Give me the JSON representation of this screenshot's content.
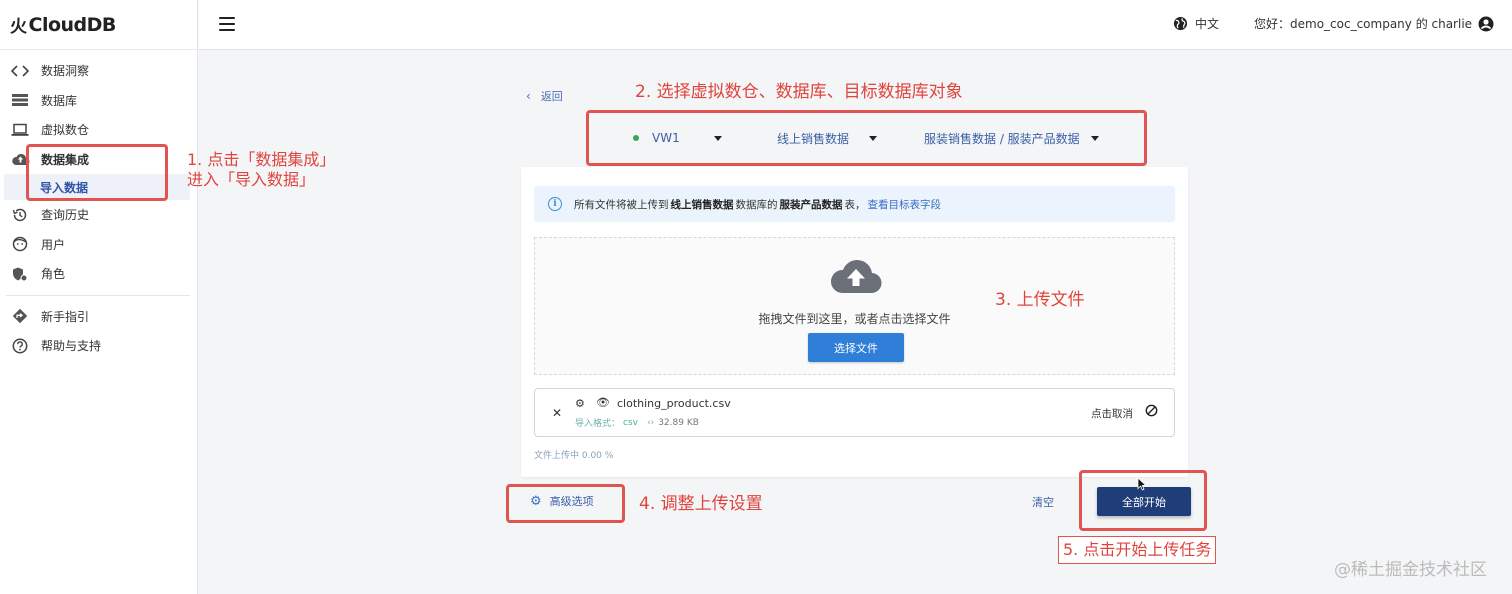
{
  "app": {
    "logo_text": "CloudDB",
    "logo_symbol": "⽕"
  },
  "sidebar": {
    "items": [
      {
        "label": "数据洞察",
        "icon": "code-icon"
      },
      {
        "label": "数据库",
        "icon": "database-icon"
      },
      {
        "label": "虚拟数仓",
        "icon": "laptop-icon"
      },
      {
        "label": "数据集成",
        "icon": "cloud-upload-icon"
      },
      {
        "label": "导入数据",
        "icon": ""
      },
      {
        "label": "查询历史",
        "icon": "history-icon"
      },
      {
        "label": "用户",
        "icon": "user-face-icon"
      },
      {
        "label": "角色",
        "icon": "role-shield-icon"
      }
    ],
    "bottom_items": [
      {
        "label": "新手指引",
        "icon": "guide-diamond-icon"
      },
      {
        "label": "帮助与支持",
        "icon": "help-icon"
      }
    ]
  },
  "header": {
    "language": "中文",
    "greeting": "您好：demo_coc_company 的 charlie"
  },
  "main": {
    "back_label": "返回",
    "selectors": {
      "warehouse": "VW1",
      "database": "线上销售数据",
      "table": "服装销售数据 / 服装产品数据"
    },
    "info": {
      "prefix": "所有文件将被上传到",
      "database": "线上销售数据",
      "middle": "数据库的",
      "table": "服装产品数据",
      "suffix": "表，",
      "link": "查看目标表字段"
    },
    "dropzone": {
      "text": "拖拽文件到这里，或者点击选择文件",
      "button": "选择文件"
    },
    "file": {
      "name": "clothing_product.csv",
      "format_label": "导入格式：",
      "format_value": "csv",
      "size": "32.89 KB",
      "cancel": "点击取消"
    },
    "status": "文件上传中 0.00 %",
    "advanced_label": "高级选项",
    "clear_label": "清空",
    "start_label": "全部开始"
  },
  "annotations": {
    "step1_line1": "1. 点击「数据集成」",
    "step1_line2": "进入「导入数据」",
    "step2": "2. 选择虚拟数仓、数据库、目标数据库对象",
    "step3": "3. 上传文件",
    "step4": "4. 调整上传设置",
    "step5": "5. 点击开始上传任务"
  },
  "watermark": "@稀土掘金技术社区",
  "colors": {
    "accent": "#2f7fd8",
    "primary_dark": "#1f3d78",
    "annotation": "#e0554f"
  }
}
